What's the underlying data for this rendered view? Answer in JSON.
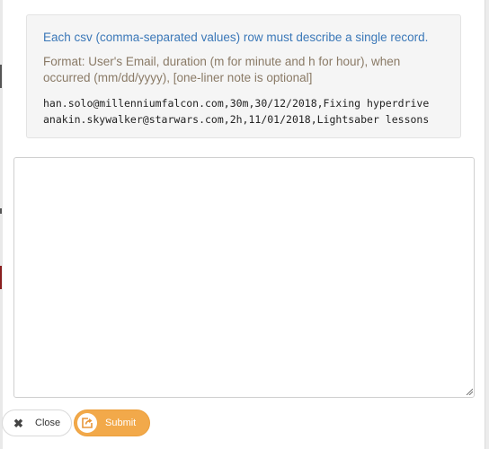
{
  "info_box": {
    "description": "Each csv (comma-separated values) row must describe a single record.",
    "format": "Format: User's Email, duration (m for minute and h for hour), when occurred (mm/dd/yyyy), [one-liner note is optional]",
    "examples": [
      "han.solo@millenniumfalcon.com,30m,30/12/2018,Fixing hyperdrive",
      "anakin.skywalker@starwars.com,2h,11/01/2018,Lightsaber lessons"
    ]
  },
  "textarea": {
    "value": "",
    "placeholder": ""
  },
  "buttons": {
    "close_label": "Close",
    "close_icon": "close-x-icon",
    "submit_label": "Submit",
    "submit_icon": "share-arrow-icon"
  },
  "colors": {
    "info_text": "#3b78b8",
    "format_text": "#8a7a66",
    "submit_background": "#f2a94a"
  }
}
